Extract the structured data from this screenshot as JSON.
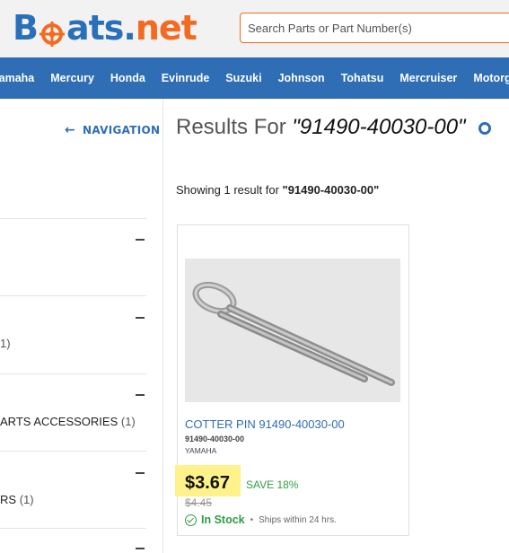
{
  "brand": {
    "logo_part1": "B",
    "logo_part2": "ats.",
    "logo_part3": "net"
  },
  "search": {
    "placeholder": "Search Parts or Part Number(s)"
  },
  "navbar": [
    "Yamaha",
    "Mercury",
    "Honda",
    "Evinrude",
    "Suzuki",
    "Johnson",
    "Tohatsu",
    "Mercruiser",
    "Motorguide"
  ],
  "sidebar": {
    "navigation_label": "NAVIGATION",
    "facets": [
      {
        "text": "",
        "count": ""
      },
      {
        "text": "",
        "count": "1)"
      },
      {
        "text": "ARTS ACCESSORIES",
        "count": "(1)"
      },
      {
        "text": "RS",
        "count": "(1)"
      }
    ]
  },
  "results": {
    "prefix": "Results For",
    "query": "\"91490-40030-00\"",
    "showing_prefix": "Showing 1 result for",
    "showing_query": "\"91490-40030-00\""
  },
  "product": {
    "title": "COTTER PIN 91490-40030-00",
    "part_number": "91490-40030-00",
    "brand": "YAMAHA",
    "price": "$3.67",
    "save": "SAVE 18%",
    "old_price": "$4.45",
    "stock": "In Stock",
    "ships": "Ships within 24 hrs."
  },
  "colors": {
    "brand_blue": "#2a6fba",
    "brand_orange": "#f26b21",
    "nav_blue": "#2f6db5",
    "stock_green": "#2e9e44",
    "highlight": "#fff28a"
  }
}
